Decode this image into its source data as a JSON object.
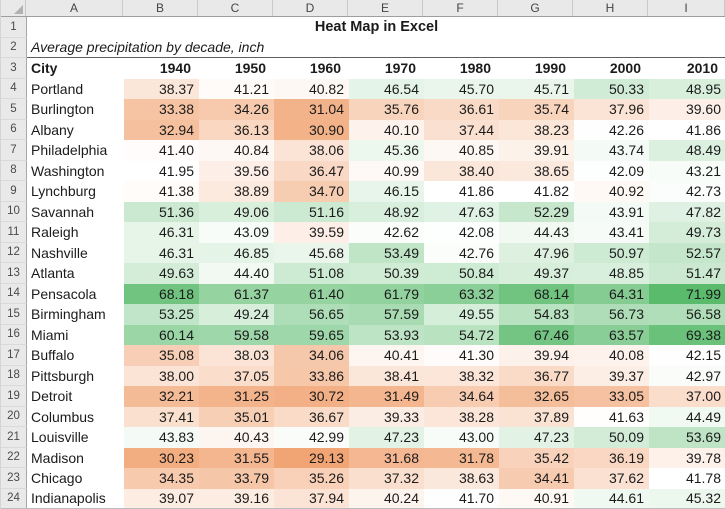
{
  "title": "Heat Map in Excel",
  "subtitle": "Average precipitation by decade, inch",
  "sheet": {
    "column_letters": [
      "A",
      "B",
      "C",
      "D",
      "E",
      "F",
      "G",
      "H",
      "I"
    ],
    "row_count": 24
  },
  "table": {
    "columns": [
      "City",
      "1940",
      "1950",
      "1960",
      "1970",
      "1980",
      "1990",
      "2000",
      "2010"
    ],
    "rows": [
      {
        "city": "Portland",
        "values": [
          "38.37",
          "41.21",
          "40.82",
          "46.54",
          "45.70",
          "45.71",
          "50.33",
          "48.95"
        ]
      },
      {
        "city": "Burlington",
        "values": [
          "33.38",
          "34.26",
          "31.04",
          "35.76",
          "36.61",
          "35.74",
          "37.96",
          "39.60"
        ]
      },
      {
        "city": "Albany",
        "values": [
          "32.94",
          "36.13",
          "30.90",
          "40.10",
          "37.44",
          "38.23",
          "42.26",
          "41.86"
        ]
      },
      {
        "city": "Philadelphia",
        "values": [
          "41.40",
          "40.84",
          "38.06",
          "45.36",
          "40.85",
          "39.91",
          "43.74",
          "48.49"
        ]
      },
      {
        "city": "Washington",
        "values": [
          "41.95",
          "39.56",
          "36.47",
          "40.99",
          "38.40",
          "38.65",
          "42.09",
          "43.21"
        ]
      },
      {
        "city": "Lynchburg",
        "values": [
          "41.38",
          "38.89",
          "34.70",
          "46.15",
          "41.86",
          "41.82",
          "40.92",
          "42.73"
        ]
      },
      {
        "city": "Savannah",
        "values": [
          "51.36",
          "49.06",
          "51.16",
          "48.92",
          "47.63",
          "52.29",
          "43.91",
          "47.82"
        ]
      },
      {
        "city": "Raleigh",
        "values": [
          "46.31",
          "43.09",
          "39.59",
          "42.62",
          "42.08",
          "44.43",
          "43.41",
          "49.73"
        ]
      },
      {
        "city": "Nashville",
        "values": [
          "46.31",
          "46.85",
          "45.68",
          "53.49",
          "42.76",
          "47.96",
          "50.97",
          "52.57"
        ]
      },
      {
        "city": "Atlanta",
        "values": [
          "49.63",
          "44.40",
          "51.08",
          "50.39",
          "50.84",
          "49.37",
          "48.85",
          "51.47"
        ]
      },
      {
        "city": "Pensacola",
        "values": [
          "68.18",
          "61.37",
          "61.40",
          "61.79",
          "63.32",
          "68.14",
          "64.31",
          "71.99"
        ]
      },
      {
        "city": "Birmingham",
        "values": [
          "53.25",
          "49.24",
          "56.65",
          "57.59",
          "49.55",
          "54.83",
          "56.73",
          "56.58"
        ]
      },
      {
        "city": "Miami",
        "values": [
          "60.14",
          "59.58",
          "59.65",
          "53.93",
          "54.72",
          "67.46",
          "63.57",
          "69.38"
        ]
      },
      {
        "city": "Buffalo",
        "values": [
          "35.08",
          "38.03",
          "34.06",
          "40.41",
          "41.30",
          "39.94",
          "40.08",
          "42.15"
        ]
      },
      {
        "city": "Pittsburgh",
        "values": [
          "38.00",
          "37.05",
          "33.86",
          "38.41",
          "38.32",
          "36.77",
          "39.37",
          "42.97"
        ]
      },
      {
        "city": "Detroit",
        "values": [
          "32.21",
          "31.25",
          "30.72",
          "31.49",
          "34.64",
          "32.65",
          "33.05",
          "37.00"
        ]
      },
      {
        "city": "Columbus",
        "values": [
          "37.41",
          "35.01",
          "36.67",
          "39.33",
          "38.28",
          "37.89",
          "41.63",
          "44.49"
        ]
      },
      {
        "city": "Louisville",
        "values": [
          "43.83",
          "40.43",
          "42.99",
          "47.23",
          "43.00",
          "47.23",
          "50.09",
          "53.69"
        ]
      },
      {
        "city": "Madison",
        "values": [
          "30.23",
          "31.55",
          "29.13",
          "31.68",
          "31.78",
          "35.42",
          "36.19",
          "39.78"
        ]
      },
      {
        "city": "Chicago",
        "values": [
          "34.35",
          "33.79",
          "35.26",
          "37.32",
          "38.63",
          "34.41",
          "37.62",
          "41.78"
        ]
      },
      {
        "city": "Indianapolis",
        "values": [
          "39.07",
          "39.16",
          "37.94",
          "40.24",
          "41.70",
          "40.91",
          "44.61",
          "45.32"
        ]
      }
    ]
  },
  "heat_scale": {
    "min_color": "#F1A575",
    "mid_color": "#FFFFFF",
    "max_color": "#5BBB6D"
  }
}
